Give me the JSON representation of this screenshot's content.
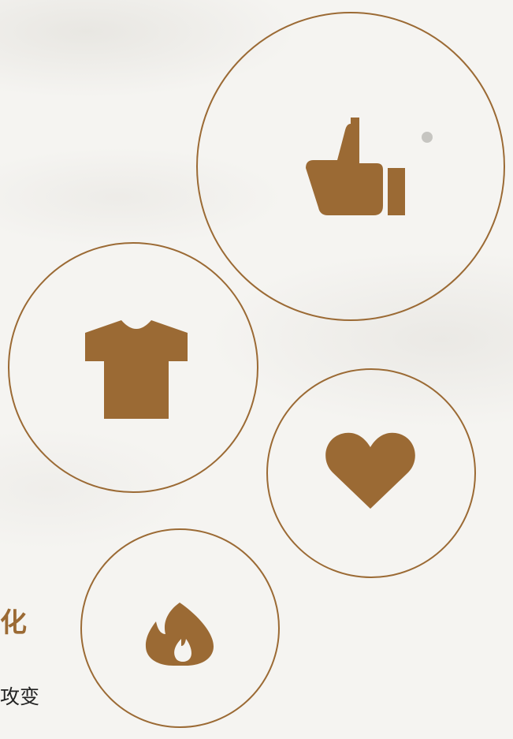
{
  "text": {
    "heading_fragment": "化",
    "body_fragment": "攻变"
  },
  "icons": [
    "thumbs-up-icon",
    "t-shirt-icon",
    "heart-icon",
    "fire-icon"
  ],
  "colors": {
    "accent": "#9b6a34",
    "background": "#f5f4f1",
    "body_text": "#222222",
    "dot": "#c6c5c1"
  }
}
